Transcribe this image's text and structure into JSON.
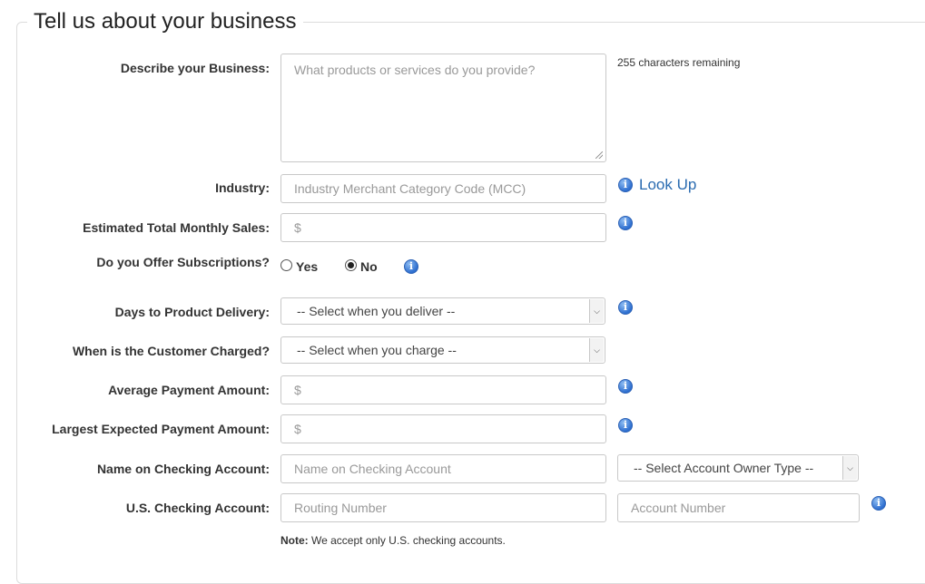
{
  "section": {
    "title": "Tell us about your business"
  },
  "describe": {
    "label": "Describe your Business:",
    "placeholder": "What products or services do you provide?",
    "chars_remaining": "255 characters remaining"
  },
  "industry": {
    "label": "Industry:",
    "placeholder": "Industry Merchant Category Code (MCC)",
    "lookup_label": "Look Up"
  },
  "monthly_sales": {
    "label": "Estimated Total Monthly Sales:",
    "placeholder": "$"
  },
  "subscriptions": {
    "label": "Do you Offer Subscriptions?",
    "yes_label": "Yes",
    "no_label": "No",
    "selected": "No"
  },
  "delivery": {
    "label": "Days to Product Delivery:",
    "selected": "-- Select when you deliver --"
  },
  "charged": {
    "label": "When is the Customer Charged?",
    "selected": "-- Select when you charge --"
  },
  "avg_payment": {
    "label": "Average Payment Amount:",
    "placeholder": "$"
  },
  "largest_payment": {
    "label": "Largest Expected Payment Amount:",
    "placeholder": "$"
  },
  "checking_name": {
    "label": "Name on Checking Account:",
    "placeholder": "Name on Checking Account",
    "owner_type_selected": "-- Select Account Owner Type --"
  },
  "checking_account": {
    "label": "U.S. Checking Account:",
    "routing_placeholder": "Routing Number",
    "account_placeholder": "Account Number"
  },
  "note": {
    "prefix": "Note:",
    "text": " We accept only U.S. checking accounts."
  },
  "icons": {
    "info": "info-icon",
    "dropdown": "chevron-down-icon"
  },
  "colors": {
    "link": "#2a6bb0",
    "info_icon": "#2e6fd0"
  }
}
